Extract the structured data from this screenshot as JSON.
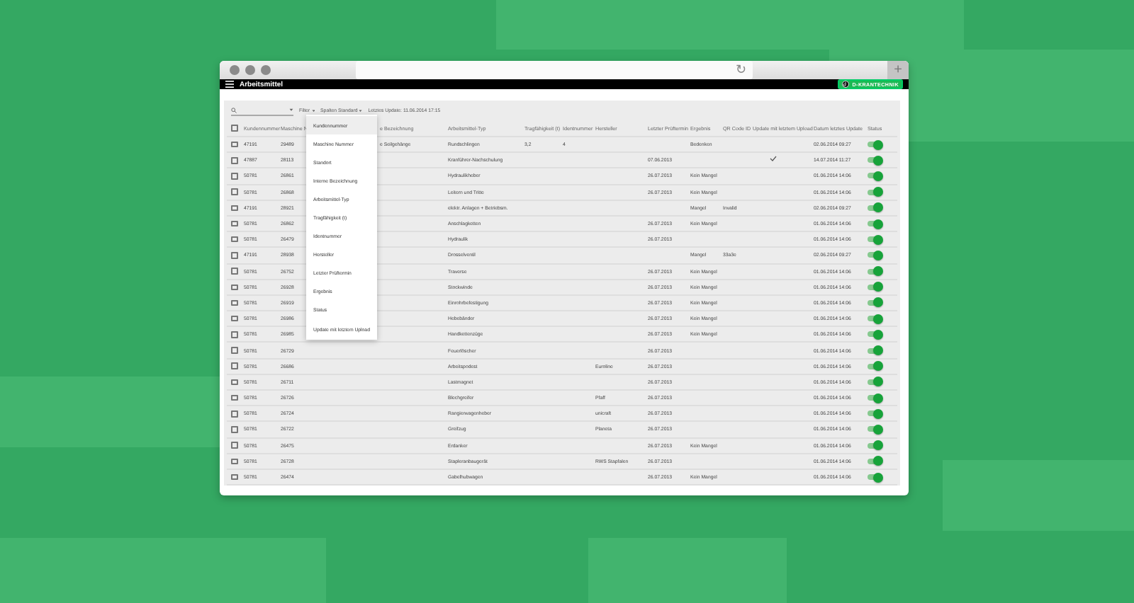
{
  "browser": {
    "reload": "↻",
    "new_tab": "+"
  },
  "app_bar": {
    "title": "Arbeitsmittel",
    "logo": "D-KRANTECHNIK"
  },
  "toolbar": {
    "filter": "Filter",
    "columns": "Spalten Standard",
    "last_update": "Letztes Update: 11.06.2014 17:15"
  },
  "all_checked": false,
  "columns": [
    "Kundennummer",
    "Maschine N",
    "e Bezeichnung",
    "Arbeitsmittel-Typ",
    "Tragfähigkeit (t)",
    "Identnummer",
    "Hersteller",
    "Letzter Prüftermin",
    "Ergebnis",
    "QR Code ID",
    "Update mit letztem Upload",
    "Datum letztes Update",
    "Status"
  ],
  "dropdown": [
    {
      "label": "Kundennummer",
      "selected": true
    },
    {
      "label": "Maschine Nummer",
      "selected": false
    },
    {
      "label": "Standort",
      "selected": false
    },
    {
      "label": "Interne Bezeichnung",
      "selected": false
    },
    {
      "label": "Arbeitsmittel-Typ",
      "selected": false
    },
    {
      "label": "Tragfähigkeit (t)",
      "selected": false
    },
    {
      "label": "Identnummer",
      "selected": false
    },
    {
      "label": "Hersteller",
      "selected": false
    },
    {
      "label": "Letzter Prüftermin",
      "selected": false
    },
    {
      "label": "Ergebnis",
      "selected": false
    },
    {
      "label": "Status",
      "selected": false
    },
    {
      "label": "Update mit letztem Upload",
      "selected": false
    }
  ],
  "rows": [
    {
      "cells": [
        "47191",
        "29489",
        "e Seilgehänge",
        "Rundschlingen",
        "3,2",
        "4",
        null,
        null,
        "Bedenken",
        null
      ],
      "updated": false,
      "date": "02.06.2014 09:27",
      "checked": false,
      "on": true
    },
    {
      "cells": [
        "47887",
        "28113",
        null,
        "Kranführer-Nachschulung",
        null,
        null,
        null,
        "07.06.2013",
        null,
        null
      ],
      "updated": true,
      "date": "14.07.2014 11:27",
      "checked": false,
      "on": true
    },
    {
      "cells": [
        "50781",
        "26861",
        null,
        "Hydraulikheber",
        null,
        null,
        null,
        "26.07.2013",
        "Kein Mangel",
        null
      ],
      "updated": false,
      "date": "01.06.2014 14:06",
      "checked": false,
      "on": true
    },
    {
      "cells": [
        "50781",
        "26868",
        null,
        "Leitern und Tritte",
        null,
        null,
        null,
        "26.07.2013",
        "Kein Mangel",
        null
      ],
      "updated": false,
      "date": "01.06.2014 14:06",
      "checked": false,
      "on": true
    },
    {
      "cells": [
        "47191",
        "28921",
        null,
        "elektr. Anlagen + Betriebsm.",
        null,
        null,
        null,
        null,
        "Mangel",
        "Invalid"
      ],
      "updated": false,
      "date": "02.06.2014 09:27",
      "checked": false,
      "on": true
    },
    {
      "cells": [
        "50781",
        "26862",
        null,
        "Anschlagketten",
        null,
        null,
        null,
        "26.07.2013",
        "Kein Mangel",
        null
      ],
      "updated": false,
      "date": "01.06.2014 14:06",
      "checked": false,
      "on": true
    },
    {
      "cells": [
        "50781",
        "26479",
        null,
        "Hydraulik",
        null,
        null,
        null,
        "26.07.2013",
        null,
        null
      ],
      "updated": false,
      "date": "01.06.2014 14:06",
      "checked": false,
      "on": true
    },
    {
      "cells": [
        "47191",
        "28938",
        null,
        "Drosselventil",
        null,
        null,
        null,
        null,
        "Mangel",
        "33a3e"
      ],
      "updated": false,
      "date": "02.06.2014 09:27",
      "checked": false,
      "on": true
    },
    {
      "cells": [
        "50781",
        "26752",
        null,
        "Traverse",
        null,
        null,
        null,
        "26.07.2013",
        "Kein Mangel",
        null
      ],
      "updated": false,
      "date": "01.06.2014 14:06",
      "checked": false,
      "on": true
    },
    {
      "cells": [
        "50781",
        "26928",
        null,
        "Stockwinde",
        null,
        null,
        null,
        "26.07.2013",
        "Kein Mangel",
        null
      ],
      "updated": false,
      "date": "01.06.2014 14:06",
      "checked": false,
      "on": true
    },
    {
      "cells": [
        "50781",
        "26919",
        null,
        "Einrohrbefestigung",
        null,
        null,
        null,
        "26.07.2013",
        "Kein Mangel",
        null
      ],
      "updated": false,
      "date": "01.06.2014 14:06",
      "checked": false,
      "on": true
    },
    {
      "cells": [
        "50781",
        "26986",
        null,
        "Hebebänder",
        null,
        null,
        null,
        "26.07.2013",
        "Kein Mangel",
        null
      ],
      "updated": false,
      "date": "01.06.2014 14:06",
      "checked": false,
      "on": true
    },
    {
      "cells": [
        "50781",
        "26985",
        null,
        "Handkettenzüge",
        null,
        null,
        null,
        "26.07.2013",
        "Kein Mangel",
        null
      ],
      "updated": false,
      "date": "01.06.2014 14:06",
      "checked": false,
      "on": true
    },
    {
      "cells": [
        "50781",
        "26729",
        null,
        "Feuerlöscher",
        null,
        null,
        null,
        "26.07.2013",
        null,
        null
      ],
      "updated": false,
      "date": "01.06.2014 14:06",
      "checked": false,
      "on": true
    },
    {
      "cells": [
        "50781",
        "26686",
        null,
        "Arbeitspodest",
        null,
        null,
        "Euroline",
        "26.07.2013",
        null,
        null
      ],
      "updated": false,
      "date": "01.06.2014 14:06",
      "checked": false,
      "on": true
    },
    {
      "cells": [
        "50781",
        "26711",
        null,
        "Lastmagnet",
        null,
        null,
        null,
        "26.07.2013",
        null,
        null
      ],
      "updated": false,
      "date": "01.06.2014 14:06",
      "checked": false,
      "on": true
    },
    {
      "cells": [
        "50781",
        "26726",
        null,
        "Blechgreifer",
        null,
        null,
        "Pfaff",
        "26.07.2013",
        null,
        null
      ],
      "updated": false,
      "date": "01.06.2014 14:06",
      "checked": false,
      "on": true
    },
    {
      "cells": [
        "50781",
        "26724",
        null,
        "Rangierwagenheber",
        null,
        null,
        "unicraft",
        "26.07.2013",
        null,
        null
      ],
      "updated": false,
      "date": "01.06.2014 14:06",
      "checked": false,
      "on": true
    },
    {
      "cells": [
        "50781",
        "26722",
        null,
        "Greifzug",
        null,
        null,
        "Planeta",
        "26.07.2013",
        null,
        null
      ],
      "updated": false,
      "date": "01.06.2014 14:06",
      "checked": false,
      "on": true
    },
    {
      "cells": [
        "50781",
        "26475",
        null,
        "Erdanker",
        null,
        null,
        null,
        "26.07.2013",
        "Kein Mangel",
        null
      ],
      "updated": false,
      "date": "01.06.2014 14:06",
      "checked": false,
      "on": true
    },
    {
      "cells": [
        "50781",
        "26728",
        null,
        "Stapleranbaugerät",
        null,
        null,
        "RWS Stapfalen",
        "26.07.2013",
        null,
        null
      ],
      "updated": false,
      "date": "01.06.2014 14:06",
      "checked": false,
      "on": true
    },
    {
      "cells": [
        "50781",
        "26474",
        null,
        "Gabelhubwagen",
        null,
        null,
        null,
        "26.07.2013",
        "Kein Mangel",
        null
      ],
      "updated": false,
      "date": "01.06.2014 14:06",
      "checked": false,
      "on": true
    }
  ]
}
